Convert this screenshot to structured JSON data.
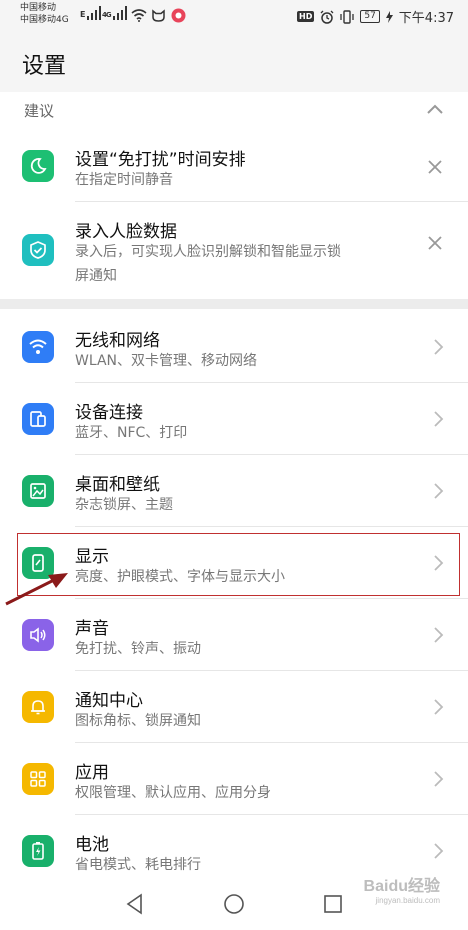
{
  "status_bar": {
    "carrier1": "中国移动",
    "carrier2": "中国移动4G",
    "net1": "E",
    "net2": "4G",
    "hd": "HD",
    "battery": "57",
    "time": "下午4:37"
  },
  "page_title": "设置",
  "suggestions": {
    "label": "建议",
    "items": [
      {
        "title": "设置“免打扰”时间安排",
        "subtitle": "在指定时间静音",
        "icon": "moon-icon",
        "color": "#1dbf73"
      },
      {
        "title": "录入人脸数据",
        "subtitle_line1": "录入后，可实现人脸识别解锁和智能显示锁",
        "subtitle_line2": "屏通知",
        "icon": "shield-check-icon",
        "color": "#1fbfbf"
      }
    ]
  },
  "settings": [
    {
      "title": "无线和网络",
      "subtitle": "WLAN、双卡管理、移动网络",
      "icon": "wifi-icon",
      "color": "#2f7df6"
    },
    {
      "title": "设备连接",
      "subtitle": "蓝牙、NFC、打印",
      "icon": "device-link-icon",
      "color": "#2f7df6"
    },
    {
      "title": "桌面和壁纸",
      "subtitle": "杂志锁屏、主题",
      "icon": "wallpaper-icon",
      "color": "#19b06b"
    },
    {
      "title": "显示",
      "subtitle": "亮度、护眼模式、字体与显示大小",
      "icon": "phone-display-icon",
      "color": "#19b06b"
    },
    {
      "title": "声音",
      "subtitle": "免打扰、铃声、振动",
      "icon": "speaker-icon",
      "color": "#8a63e8"
    },
    {
      "title": "通知中心",
      "subtitle": "图标角标、锁屏通知",
      "icon": "bell-icon",
      "color": "#f5b800"
    },
    {
      "title": "应用",
      "subtitle": "权限管理、默认应用、应用分身",
      "icon": "apps-grid-icon",
      "color": "#f5b800"
    },
    {
      "title": "电池",
      "subtitle": "省电模式、耗电排行",
      "icon": "battery-icon",
      "color": "#19b06b"
    }
  ],
  "watermark": {
    "brand": "Baidu经验",
    "url": "jingyan.baidu.com"
  }
}
